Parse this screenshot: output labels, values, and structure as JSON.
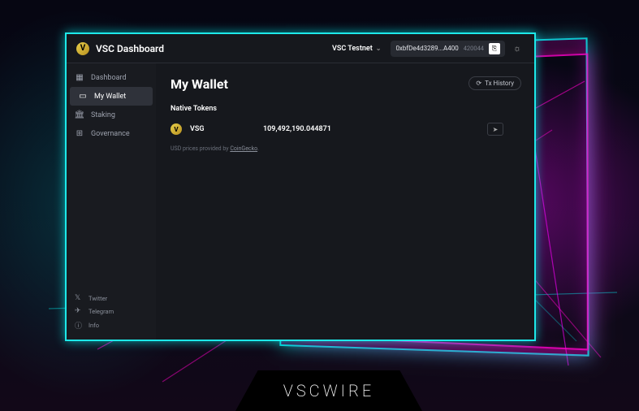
{
  "header": {
    "app_title": "VSC Dashboard",
    "network": "VSC Testnet",
    "address": "0xbfDe4d3289...A400",
    "block_number": "420044"
  },
  "sidebar": {
    "items": [
      {
        "label": "Dashboard",
        "icon": "▦"
      },
      {
        "label": "My Wallet",
        "icon": "▭"
      },
      {
        "label": "Staking",
        "icon": "🏛"
      },
      {
        "label": "Governance",
        "icon": "⊞"
      }
    ],
    "socials": [
      {
        "label": "Twitter",
        "icon": "𝕏"
      },
      {
        "label": "Telegram",
        "icon": "✈"
      },
      {
        "label": "Info",
        "icon": "ⓘ"
      }
    ]
  },
  "main": {
    "page_title": "My Wallet",
    "tx_history_label": "Tx History",
    "native_tokens_label": "Native Tokens",
    "tokens": [
      {
        "symbol": "VSG",
        "amount": "109,492,190.044871"
      }
    ],
    "price_note_prefix": "USD prices provided by ",
    "price_provider": "CoinGecko",
    "price_note_suffix": "."
  },
  "banner": "VSCWIRE"
}
